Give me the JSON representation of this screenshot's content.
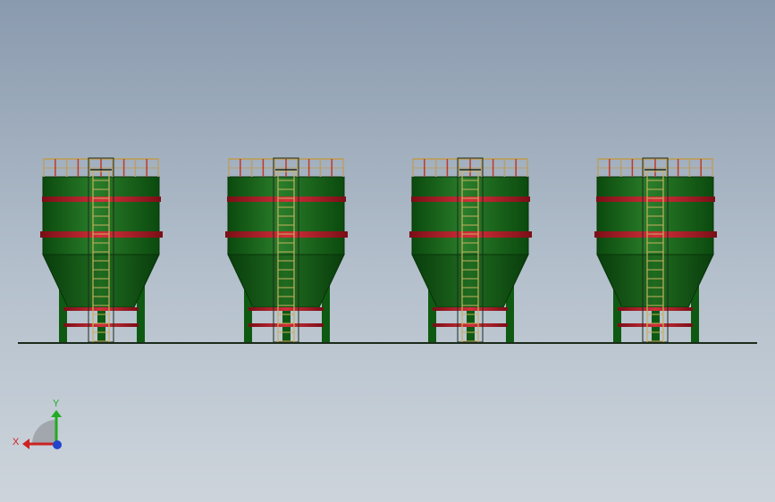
{
  "viewport": {
    "background_top": "#8a9aae",
    "background_bottom": "#cdd4db"
  },
  "model": {
    "silo_count": 4,
    "colors": {
      "body": "#0f5a12",
      "body_highlight": "#2a7d2a",
      "band": "#a0141e",
      "band_light": "#d0303a",
      "railing": "#b8a06a",
      "ladder": "#c8b060",
      "ground": "#1a2a1a"
    }
  },
  "triad": {
    "x_label": "X",
    "y_label": "Y",
    "x_color": "#cc2222",
    "y_color": "#22aa22",
    "z_color": "#2244cc"
  }
}
